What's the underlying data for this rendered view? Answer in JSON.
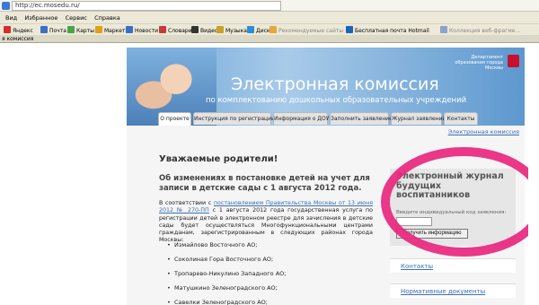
{
  "browser": {
    "address": "http://ec.mosedu.ru/",
    "menu": [
      "Вид",
      "Избранное",
      "Сервис",
      "Справка"
    ],
    "bookmarks": [
      {
        "label": "Яндекс",
        "color": "#d62c2c",
        "dim": false
      },
      {
        "label": "Почта",
        "color": "#3a6fc4",
        "dim": false
      },
      {
        "label": "Карты",
        "color": "#4aa24a",
        "dim": false
      },
      {
        "label": "Маркет",
        "color": "#e0a01a",
        "dim": false
      },
      {
        "label": "Новости",
        "color": "#3a6fc4",
        "dim": false
      },
      {
        "label": "Словари",
        "color": "#c83a3a",
        "dim": false
      },
      {
        "label": "Видео",
        "color": "#333333",
        "dim": false
      },
      {
        "label": "Музыка",
        "color": "#c8a12a",
        "dim": false
      },
      {
        "label": "Диск",
        "color": "#2b8dd6",
        "dim": false
      },
      {
        "label": "Рекомендуемые сайты",
        "color": "#e6a83a",
        "dim": true
      },
      {
        "label": "Бесплатная почта Hotmail",
        "color": "#1d64b8",
        "dim": false
      },
      {
        "label": "Коллекция веб-фрагме...",
        "color": "#8aa3c8",
        "dim": true
      }
    ],
    "tab_title": "я комиссия"
  },
  "banner": {
    "title": "Электронная комиссия",
    "subtitle": "по комплектованию дошкольных образовательных учреждений",
    "department": "Департамент образования города Москвы"
  },
  "nav": {
    "tabs": [
      {
        "label": "О проекте",
        "active": true
      },
      {
        "label": "Инструкция по регистрации",
        "active": false
      },
      {
        "label": "Информация о ДОУ",
        "active": false
      },
      {
        "label": "Заполнить заявление",
        "active": false
      },
      {
        "label": "Журнал заявлений",
        "active": false
      },
      {
        "label": "Контакты",
        "active": false
      }
    ]
  },
  "breadcrumb": "Электронная комиссия",
  "main": {
    "welcome": "Уважаемые родители!",
    "change_heading": "Об изменениях в постановке детей на учет для записи в детские сады с 1 августа 2012 года.",
    "para_prefix": "В соответствии с ",
    "para_link": "постановлением Правительства Москвы от 13 июня 2012 № 270-ПП",
    "para_rest": " с 1 августа 2012 года государственная услуга по регистрации детей в электронном реестре для зачисления в детские сады будет осуществляться Многофункциональными центрами гражданам, зарегистрированным в следующих районах города Москвы:",
    "districts": [
      "Измайлово Восточного АО;",
      "Соколиная Гора Восточного АО;",
      "Тропарево-Никулино Западного АО;",
      "Матушкино Зеленоградского АО;",
      "Савелки Зеленоградского АО;"
    ]
  },
  "journal": {
    "title": "Электронный журнал будущих воспитанников",
    "code_label": "Введите индивидуальный код заявления:",
    "button": "Получить информацию"
  },
  "side_links": {
    "contacts": "Контакты",
    "docs": "Нормативные документы"
  }
}
